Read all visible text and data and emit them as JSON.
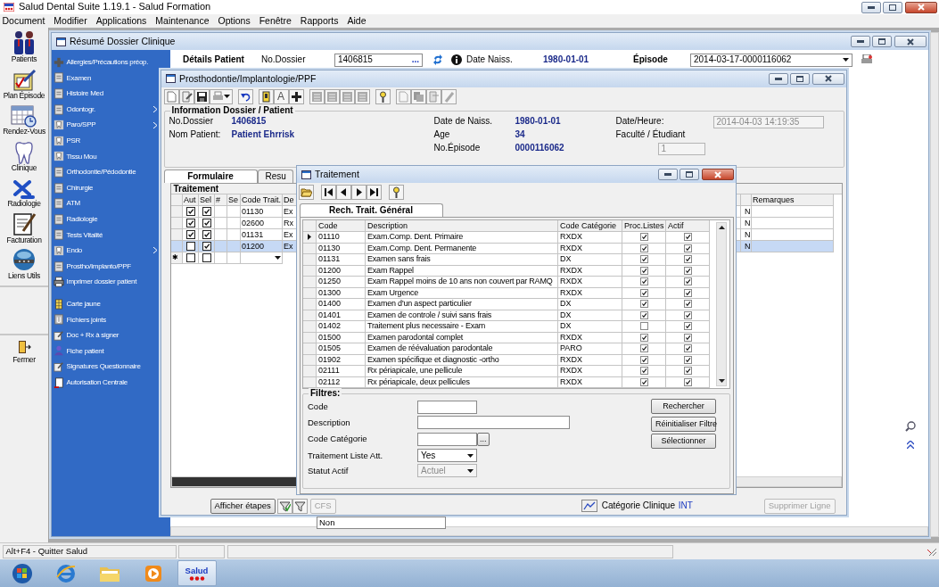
{
  "app": {
    "title": "Salud Dental Suite 1.19.1 - Salud Formation"
  },
  "menu": [
    "Document",
    "Modifier",
    "Applications",
    "Maintenance",
    "Options",
    "Fenêtre",
    "Rapports",
    "Aide"
  ],
  "sidebar": [
    {
      "label": "Patients"
    },
    {
      "label": "Plan Épisode"
    },
    {
      "label": "Rendez-Vous"
    },
    {
      "label": "Clinique"
    },
    {
      "label": "Radiologie"
    },
    {
      "label": "Facturation"
    },
    {
      "label": "Liens Utils"
    }
  ],
  "sidebar_exit": {
    "label": "Fermer"
  },
  "resume_window": {
    "title": "Résumé Dossier Clinique",
    "nav_groups": [
      [
        {
          "label": "Allergies/Précautions préop.",
          "submenu": false
        },
        {
          "label": "Examen",
          "submenu": false
        },
        {
          "label": "Histoire Med",
          "submenu": false
        },
        {
          "label": "Odontogr.",
          "submenu": true
        },
        {
          "label": "Paro/SPP",
          "submenu": true
        },
        {
          "label": "PSR",
          "submenu": false
        },
        {
          "label": "Tissu Mou",
          "submenu": false
        },
        {
          "label": "Orthodontie/Pédodontie",
          "submenu": false
        },
        {
          "label": "Chirurgie",
          "submenu": false
        },
        {
          "label": "ATM",
          "submenu": false
        },
        {
          "label": "Radiologie",
          "submenu": false
        },
        {
          "label": "Tests Vitalité",
          "submenu": false
        },
        {
          "label": "Endo",
          "submenu": true
        },
        {
          "label": "Prostho/Implanto/PPF",
          "submenu": false
        },
        {
          "label": "Imprimer dossier patient",
          "submenu": false
        }
      ],
      [
        {
          "label": "Carte jaune",
          "submenu": false
        },
        {
          "label": "Fichiers joints",
          "submenu": false
        },
        {
          "label": "Doc + Rx à signer",
          "submenu": false
        },
        {
          "label": "Fiche patient",
          "submenu": false
        },
        {
          "label": "Signatures Questionnaire",
          "submenu": false
        },
        {
          "label": "Autorisation Centrale",
          "submenu": false
        }
      ]
    ],
    "header": {
      "heading": "Détails Patient",
      "dossier_label": "No.Dossier",
      "dossier_value": "1406815",
      "lookup": "...",
      "dob_label": "Date Naiss.",
      "dob_value": "1980-01-01",
      "episode_label": "Épisode",
      "episode_value": "2014-03-17-0000116062"
    }
  },
  "prostho_window": {
    "title": "Prosthodontie/Implantologie/PPF",
    "toolbar_letter": "A",
    "info": {
      "legend": "Information Dossier / Patient",
      "left": [
        {
          "label": "No.Dossier",
          "value": "1406815"
        },
        {
          "label": "Nom Patient:",
          "value": "Patient Ehrrisk"
        }
      ],
      "middle": [
        {
          "label": "Date de Naiss.",
          "value": "1980-01-01"
        },
        {
          "label": "Age",
          "value": "34"
        },
        {
          "label": "No.Épisode",
          "value": "0000116062"
        }
      ],
      "datetime": {
        "label": "Date/Heure:",
        "value": "2014-04-03 14:19:35",
        "disabled": true
      },
      "faculty": {
        "label": "Faculté / Étudiant",
        "value": "1",
        "disabled": true
      }
    },
    "tabs": [
      {
        "label": "Formulaire",
        "selected": true
      },
      {
        "label": "Resu",
        "selected": false
      }
    ],
    "grid": {
      "title": "Traitement",
      "columns": [
        "Aut",
        "Sel",
        "#",
        "Se",
        "Code Trait.",
        "De"
      ],
      "remarks_column": "Remarques",
      "rows": [
        {
          "aut": true,
          "sel": true,
          "code": "01130",
          "desc": "Ex",
          "flag": "N",
          "selected": false
        },
        {
          "aut": true,
          "sel": true,
          "code": "02600",
          "desc": "Rx",
          "flag": "N",
          "selected": false
        },
        {
          "aut": true,
          "sel": true,
          "code": "01131",
          "desc": "Ex",
          "flag": "N",
          "selected": false
        },
        {
          "aut": false,
          "sel": true,
          "code": "01200",
          "desc": "Ex",
          "flag": "N",
          "selected": true
        }
      ],
      "new_row": {
        "marker": "✱",
        "aut": false,
        "sel": false
      }
    },
    "bottom": {
      "steps_button": "Afficher étapes",
      "cfs_button": {
        "label": "CFS",
        "disabled": true
      },
      "category_label": "Catégorie Clinique",
      "category_value": "INT",
      "delete_button": {
        "label": "Supprimer Ligne",
        "disabled": true
      }
    }
  },
  "treatment_dialog": {
    "title": "Traitement",
    "tab": "Rech. Trait. Général",
    "columns": [
      "Code",
      "Description",
      "Code Catégorie",
      "Proc.Listes",
      "Actif"
    ],
    "rows": [
      {
        "code": "01110",
        "description": "Exam.Comp. Dent. Primaire",
        "category": "RXDX",
        "proc_listes": true,
        "actif": true,
        "current": true
      },
      {
        "code": "01130",
        "description": "Exam.Comp. Dent. Permanente",
        "category": "RXDX",
        "proc_listes": true,
        "actif": true,
        "current": false
      },
      {
        "code": "01131",
        "description": "Examen sans frais",
        "category": "DX",
        "proc_listes": true,
        "actif": true,
        "current": false
      },
      {
        "code": "01200",
        "description": "Exam Rappel",
        "category": "RXDX",
        "proc_listes": true,
        "actif": true,
        "current": false
      },
      {
        "code": "01250",
        "description": "Exam Rappel moins de 10 ans non couvert par RAMQ",
        "category": "RXDX",
        "proc_listes": true,
        "actif": true,
        "current": false
      },
      {
        "code": "01300",
        "description": "Exam Urgence",
        "category": "RXDX",
        "proc_listes": true,
        "actif": true,
        "current": false
      },
      {
        "code": "01400",
        "description": "Examen d'un aspect particulier",
        "category": "DX",
        "proc_listes": true,
        "actif": true,
        "current": false
      },
      {
        "code": "01401",
        "description": "Examen de controle / suivi sans frais",
        "category": "DX",
        "proc_listes": true,
        "actif": true,
        "current": false
      },
      {
        "code": "01402",
        "description": "Traitement plus necessaire - Exam",
        "category": "DX",
        "proc_listes": false,
        "actif": true,
        "current": false
      },
      {
        "code": "01500",
        "description": "Examen parodontal complet",
        "category": "RXDX",
        "proc_listes": true,
        "actif": true,
        "current": false
      },
      {
        "code": "01505",
        "description": "Examen de réévaluation parodontale",
        "category": "PARO",
        "proc_listes": true,
        "actif": true,
        "current": false
      },
      {
        "code": "01902",
        "description": "Examen spécifique et diagnostic -ortho",
        "category": "RXDX",
        "proc_listes": true,
        "actif": true,
        "current": false
      },
      {
        "code": "02111",
        "description": "Rx périapicale, une pellicule",
        "category": "RXDX",
        "proc_listes": true,
        "actif": true,
        "current": false
      },
      {
        "code": "02112",
        "description": "Rx périapicale, deux pellicules",
        "category": "RXDX",
        "proc_listes": true,
        "actif": true,
        "current": false
      }
    ],
    "filters": {
      "legend": "Filtres:",
      "fields": [
        {
          "label": "Code",
          "kind": "text"
        },
        {
          "label": "Description",
          "kind": "wide"
        },
        {
          "label": "Code Catégorie",
          "kind": "lookup",
          "button": "..."
        },
        {
          "label": "Traitement Liste Att.",
          "kind": "select",
          "value": "Yes",
          "disabled": false
        },
        {
          "label": "Statut Actif",
          "kind": "select",
          "value": "Actuel",
          "disabled": true
        }
      ],
      "buttons": [
        "Rechercher",
        "Réinitialiser Filtre",
        "Sélectionner"
      ]
    }
  },
  "dropdown_list": [
    "Non"
  ],
  "status_bar": [
    "Alt+F4 - Quitter Salud"
  ],
  "taskbar": [
    {
      "kind": "start",
      "selected": false
    },
    {
      "kind": "browser",
      "selected": false
    },
    {
      "kind": "folder",
      "selected": false
    },
    {
      "kind": "media",
      "selected": false
    },
    {
      "kind": "app",
      "label": "Salud",
      "selected": true
    }
  ]
}
